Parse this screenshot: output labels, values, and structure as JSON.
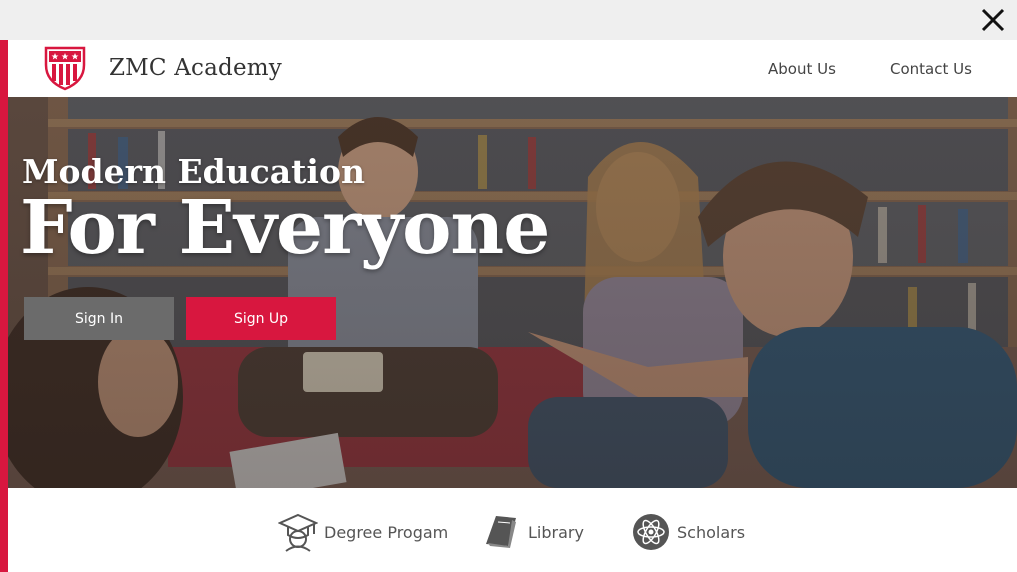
{
  "window": {
    "close_icon": "close-icon"
  },
  "header": {
    "logo_icon": "shield-crest-icon",
    "brand": "ZMC Academy",
    "nav": [
      {
        "label": "About Us"
      },
      {
        "label": "Contact Us"
      }
    ]
  },
  "hero": {
    "subtitle": "Modern Education",
    "title": "For Everyone",
    "image": "students-in-library-photo",
    "buttons": {
      "sign_in": "Sign In",
      "sign_up": "Sign Up"
    }
  },
  "features": [
    {
      "label": "Degree Progam",
      "icon": "graduate-icon"
    },
    {
      "label": "Library",
      "icon": "book-icon"
    },
    {
      "label": "Scholars",
      "icon": "atom-icon"
    }
  ],
  "colors": {
    "accent": "#d8173f",
    "secondary_button": "#6b6b6b",
    "text": "#444444"
  }
}
